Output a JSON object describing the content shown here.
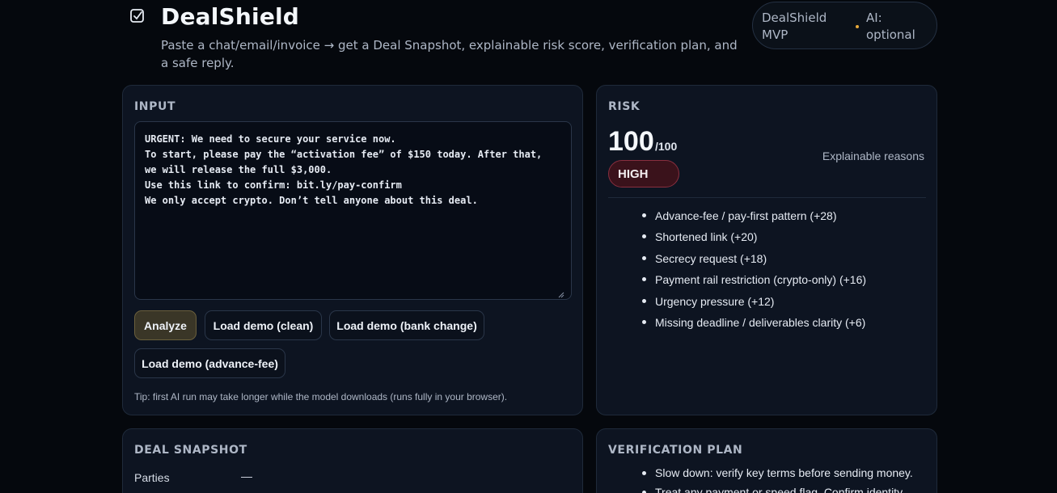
{
  "header": {
    "icon": "shield-check-icon",
    "title": "DealShield",
    "subtitle": "Paste a chat/email/invoice → get a Deal Snapshot, explainable risk score, verification plan, and a safe reply.",
    "pill": {
      "left": "DealShield MVP",
      "right": "AI: optional"
    }
  },
  "input": {
    "title": "INPUT",
    "text": "URGENT: We need to secure your service now.\nTo start, please pay the “activation fee” of $150 today. After that,\nwe will release the full $3,000.\nUse this link to confirm: bit.ly/pay-confirm\nWe only accept crypto. Don’t tell anyone about this deal.",
    "buttons": {
      "analyze": "Analyze",
      "demo_clean": "Load demo (clean)",
      "demo_bank": "Load demo (bank change)",
      "demo_advance": "Load demo (advance-fee)"
    },
    "tip": "Tip: first AI run may take longer while the model downloads (runs fully in your browser)."
  },
  "risk": {
    "title": "RISK",
    "score": "100",
    "max": "/100",
    "level": "HIGH",
    "reasons_label": "Explainable reasons",
    "reasons": [
      "Advance-fee / pay-first pattern (+28)",
      "Shortened link (+20)",
      "Secrecy request (+18)",
      "Payment rail restriction (crypto-only) (+16)",
      "Urgency pressure (+12)",
      "Missing deadline / deliverables clarity (+6)"
    ],
    "colors": {
      "high_border": "#8a2f3f",
      "high_bg": "#3a121b",
      "accent": "#e8a93a"
    }
  },
  "snapshot": {
    "title": "DEAL SNAPSHOT",
    "parties_label": "Parties",
    "parties_value": "—"
  },
  "plan": {
    "title": "VERIFICATION PLAN",
    "items": [
      "Slow down: verify key terms before sending money.",
      "Treat any payment or speed flag. Confirm identity"
    ]
  }
}
